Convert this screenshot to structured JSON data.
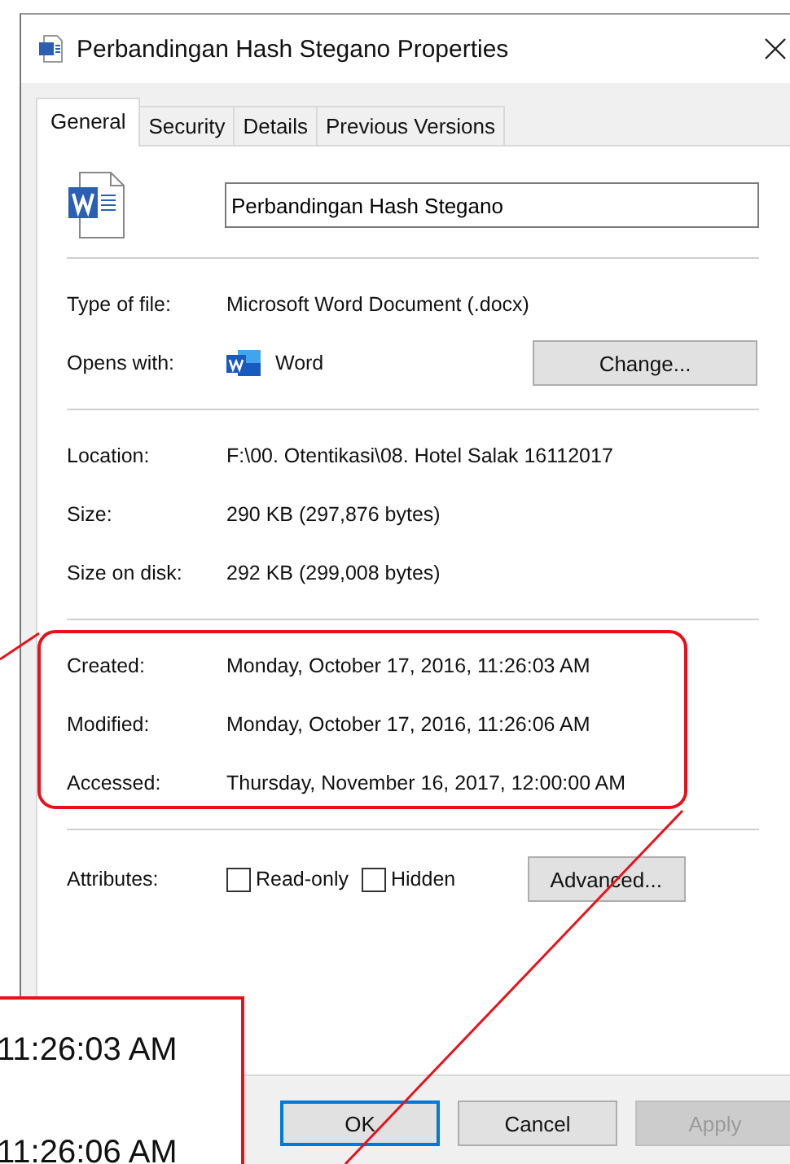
{
  "window": {
    "title": "Perbandingan Hash Stegano Properties"
  },
  "tabs": [
    {
      "label": "General",
      "selected": true
    },
    {
      "label": "Security",
      "selected": false
    },
    {
      "label": "Details",
      "selected": false
    },
    {
      "label": "Previous Versions",
      "selected": false
    }
  ],
  "file_name": "Perbandingan Hash Stegano",
  "sections": [
    [
      {
        "kind": "text",
        "label": "Type of file:",
        "value": "Microsoft Word Document (.docx)"
      },
      {
        "kind": "app",
        "label": "Opens with:",
        "value": "Word",
        "button": "Change..."
      }
    ],
    [
      {
        "kind": "text",
        "label": "Location:",
        "value": "F:\\00. Otentikasi\\08. Hotel Salak 16112017"
      },
      {
        "kind": "text",
        "label": "Size:",
        "value": "290 KB (297,876 bytes)"
      },
      {
        "kind": "text",
        "label": "Size on disk:",
        "value": "292 KB (299,008 bytes)"
      }
    ],
    [
      {
        "kind": "text",
        "label": "Created:",
        "value": "Monday, October 17, 2016, 11:26:03 AM"
      },
      {
        "kind": "text",
        "label": "Modified:",
        "value": "Monday, October 17, 2016, 11:26:06 AM"
      },
      {
        "kind": "text",
        "label": "Accessed:",
        "value": "Thursday, November 16, 2017, 12:00:00 AM"
      }
    ]
  ],
  "attributes": {
    "label": "Attributes:",
    "checkboxes": [
      {
        "label": "Read-only",
        "checked": false
      },
      {
        "label": "Hidden",
        "checked": false
      }
    ],
    "button": "Advanced..."
  },
  "buttons": [
    {
      "label": "OK",
      "default": true,
      "disabled": false
    },
    {
      "label": "Cancel",
      "default": false,
      "disabled": false
    },
    {
      "label": "Apply",
      "default": false,
      "disabled": true
    }
  ],
  "inset": {
    "lines": [
      "11:26:03 AM",
      "11:26:06 AM"
    ]
  }
}
